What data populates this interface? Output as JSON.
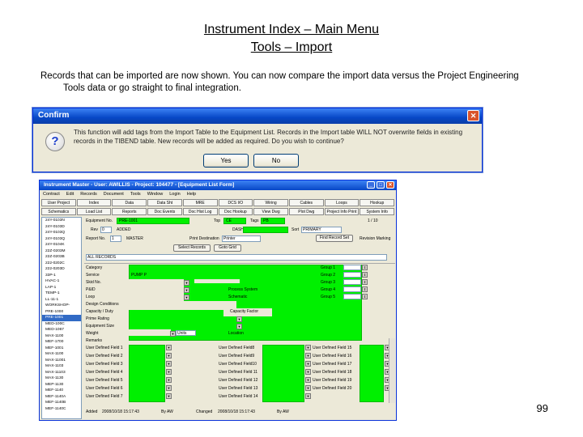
{
  "slide": {
    "title1": "Instrument Index – Main Menu",
    "title2": "Tools – Import",
    "desc1": "Records that can be imported are now shown.  You can now compare the import data versus the Project Engineering",
    "desc2": "Tools data or go straight to final integration.",
    "page_number": "99"
  },
  "confirm": {
    "title": "Confirm",
    "message": "This function will add tags from the Import Table to the Equipment List.  Records in the Import table WILL NOT overwrite fields in existing records in the TIBEND table. New records will be added as required.  Do you wish to continue?",
    "yes_label": "Yes",
    "no_label": "No"
  },
  "app": {
    "title": "Instrument Master - User: AWILLIS - Project: 104477 - [Equipment List Form]",
    "menu": [
      "Contract",
      "Edit",
      "Records",
      "Document",
      "Tools",
      "Window",
      "Login",
      "Help"
    ],
    "toolbar1": [
      "User Project",
      "Index",
      "Data",
      "Data Sht",
      "MRE",
      "DCS I/O",
      "Wiring",
      "Cables",
      "Loops",
      "Hookup"
    ],
    "toolbar2": [
      "Schematics",
      "Load List",
      "Reports",
      "Doc Events",
      "Doc Hist Log",
      "Doc Hookup",
      "View Dwg",
      "Plot Dwg",
      "Project Info Print",
      "System Info"
    ],
    "sidebar": [
      "24Y-0103N",
      "24Y-0103D",
      "24Y-0103Q",
      "24Y-0103Q",
      "24Y-0104K",
      "22Z-0203M",
      "22Z-0203B",
      "222-0202C",
      "222-0203D",
      "33P-1",
      "HVAC-1",
      "LAP-1",
      "TEMP-1",
      "LL-11-1",
      "WORKSHOP-",
      "PRE-1000",
      "PRE-1001",
      "MED-100C",
      "MED-1067",
      "MAX-1100",
      "MEF-1700",
      "MEF-1001",
      "MAX-1100",
      "MAX-11001",
      "MAX-1103",
      "MAX-11103",
      "MAX-1130",
      "MEP-1130",
      "MEF-1140",
      "MEF-1140A",
      "MEF-1140B",
      "MEF-1140C"
    ],
    "sidebar_selected_index": 16,
    "equipment_no_label": "Equipment No.",
    "equipment_no": "PRE-1001",
    "top_label": "Top",
    "top_value": "CE",
    "tags_label": "Tags",
    "tags_value": "PB",
    "page_count": "1 / 10",
    "rev_label": "Rev",
    "rev_value": "0",
    "rev_status": "ADDED",
    "dash_label": "DASH",
    "sort_label": "Sort",
    "sort_value": "PRIMARY",
    "report_no_label": "Report No.",
    "report_no": "1",
    "master_value": "MASTER",
    "print_dest_label": "Print Destination",
    "print_dest": "Printer",
    "find_record_btn": "Find Record Set",
    "revision_marking": "Revision Marking",
    "select_records_btn": "Select Records",
    "goto_grid_btn": "Goto Grid",
    "all_records": "ALL RECORDS",
    "category_label": "Category",
    "service_label": "Service",
    "service_value": "PUMP P",
    "skid_label": "Skid No.",
    "pid_label": "P&ID",
    "process_system_label": "Process System",
    "schematic_label": "Schematic",
    "loop_label": "Loop",
    "design_conditions_label": "Design Conditions",
    "capacity_duty_label": "Capacity / Duty",
    "capacity_factor_label": "Capacity Factor",
    "prime_rating_label": "Prime Rating",
    "equipment_size_label": "Equipment Size",
    "weight_label": "Weight",
    "units_label": "Units",
    "location_label": "Location",
    "remarks_label": "Remarks",
    "groups": [
      "Group 1",
      "Group 2",
      "Group 3",
      "Group 4",
      "Group 5"
    ],
    "udf_col1": [
      "User Defined Field 1",
      "User Defined Field 2",
      "User Defined Field 3",
      "User Defined Field 4",
      "User Defined Field 5",
      "User Defined Field 6",
      "User Defined Field 7"
    ],
    "udf_col2": [
      "User Defined Field8",
      "User Defined Field9",
      "User Defined Field10",
      "User Defined Field 11",
      "User Defined Field 12",
      "User Defined Field 13",
      "User Defined Field 14"
    ],
    "udf_col3": [
      "User Defined Field 15",
      "User Defined Field 16",
      "User Defined Field 17",
      "User Defined Field 18",
      "User Defined Field 19",
      "User Defined Field 20"
    ],
    "added_label": "Added",
    "added_value": "2008/10/18  15:17:43",
    "added_by_label": "By AW",
    "changed_label": "Changed",
    "changed_value": "2008/10/18  15:17:43",
    "changed_by_label": "By AW"
  }
}
